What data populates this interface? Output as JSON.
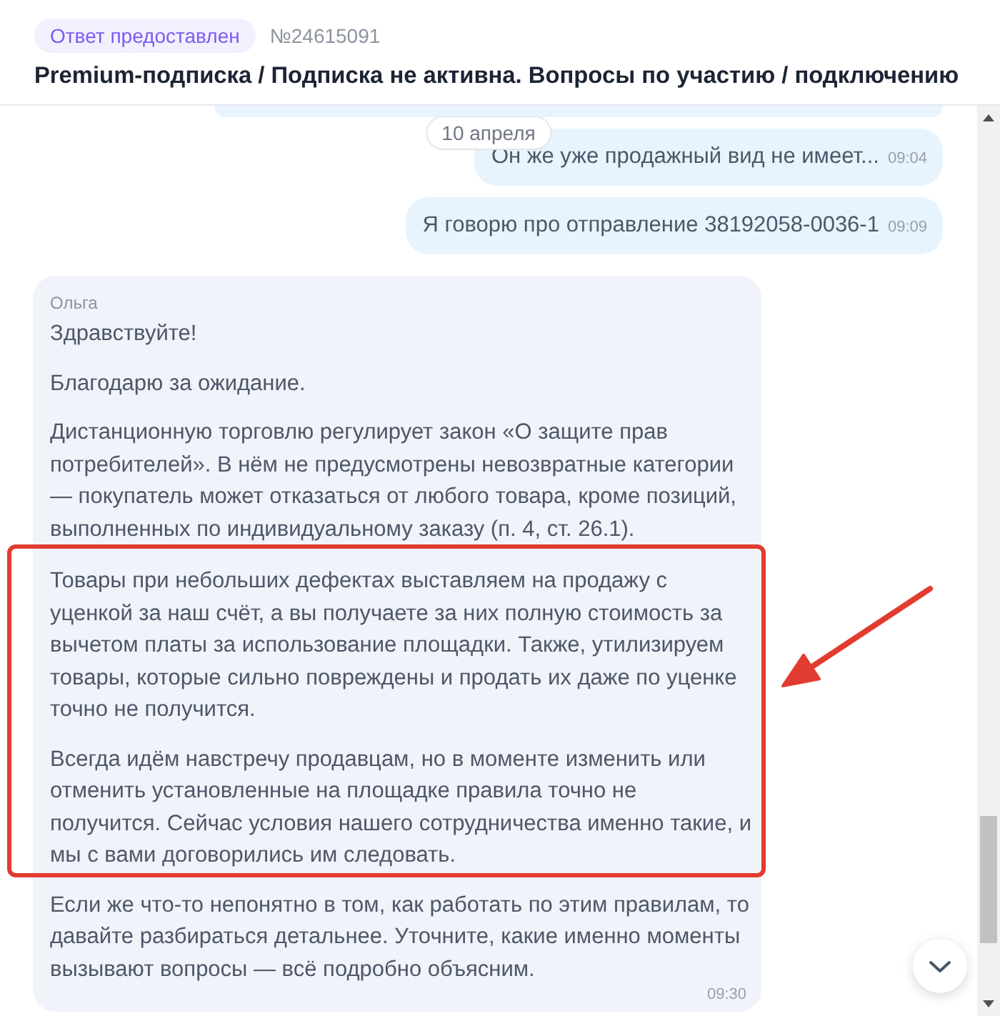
{
  "header": {
    "status": "Ответ предоставлен",
    "ticket_number": "№24615091",
    "title": "Premium-подписка / Подписка не активна. Вопросы по участию / подключению"
  },
  "chat": {
    "date_label": "10 апреля",
    "messages": [
      {
        "kind": "outgoing",
        "clipped": true
      },
      {
        "kind": "outgoing",
        "clipped": false,
        "text": "Он же уже продажный вид не имеет...",
        "time": "09:04"
      },
      {
        "kind": "outgoing",
        "clipped": false,
        "text": "Я говорю про отправление 38192058-0036-1",
        "time": "09:09"
      },
      {
        "kind": "incoming",
        "clipped": false,
        "author": "Ольга",
        "paragraphs": [
          {
            "text": "Здравствуйте!",
            "highlighted": false
          },
          {
            "text": "Благодарю за ожидание.",
            "highlighted": false
          },
          {
            "text": "Дистанционную торговлю регулирует закон «О защите прав потребителей». В нём не предусмотрены невозвратные категории — покупатель может отказаться от любого товара, кроме позиций, выполненных по индивидуальному заказу (п. 4, ст. 26.1).",
            "highlighted": false
          },
          {
            "text": "Товары при небольших дефектах выставляем на продажу с уценкой за наш счёт, а вы получаете за них полную стоимость за вычетом платы за использование площадки. Также, утилизируем товары, которые сильно повреждены и продать их даже по уценке точно не получится.",
            "highlighted": true
          },
          {
            "text": "Всегда идём навстречу продавцам, но в моменте изменить или отменить установленные на площадке правила точно не получится. Сейчас условия нашего сотрудничества именно такие, и мы с вами договорились им следовать.",
            "highlighted": true
          },
          {
            "text": "Если же что-то непонятно в том, как работать по этим правилам, то давайте разбираться детальнее. Уточните, какие именно моменты вызывают вопросы — всё подробно объясним.",
            "highlighted": false
          }
        ],
        "time": "09:30"
      }
    ]
  }
}
